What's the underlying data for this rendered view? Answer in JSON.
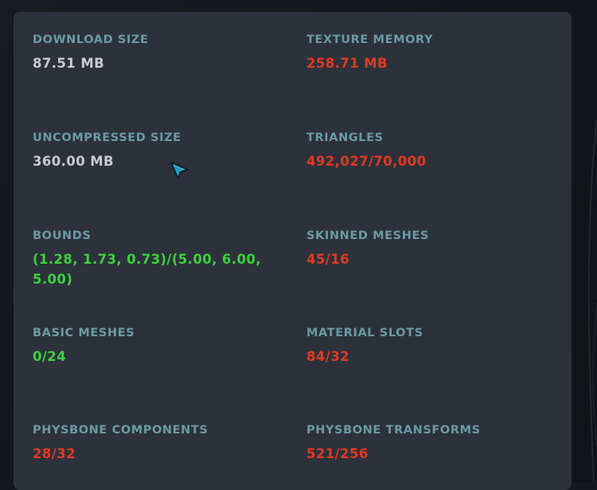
{
  "colors": {
    "label": "#6a9ba2",
    "neutral": "#c9cbcf",
    "bad": "#e03a20",
    "good": "#3ad33a"
  },
  "stats": [
    {
      "label": "DOWNLOAD SIZE",
      "value": "87.51 MB",
      "status": "neutral"
    },
    {
      "label": "TEXTURE MEMORY",
      "value": "258.71 MB",
      "status": "bad"
    },
    {
      "label": "UNCOMPRESSED SIZE",
      "value": "360.00 MB",
      "status": "neutral"
    },
    {
      "label": "TRIANGLES",
      "value": "492,027/70,000",
      "status": "bad"
    },
    {
      "label": "BOUNDS",
      "value": "(1.28, 1.73, 0.73)/(5.00, 6.00, 5.00)",
      "status": "good"
    },
    {
      "label": "SKINNED MESHES",
      "value": "45/16",
      "status": "bad"
    },
    {
      "label": "BASIC MESHES",
      "value": "0/24",
      "status": "good"
    },
    {
      "label": "MATERIAL SLOTS",
      "value": "84/32",
      "status": "bad"
    },
    {
      "label": "PHYSBONE COMPONENTS",
      "value": "28/32",
      "status": "bad"
    },
    {
      "label": "PHYSBONE TRANSFORMS",
      "value": "521/256",
      "status": "bad"
    }
  ],
  "cursor_icon": "pointer-arrow-icon"
}
